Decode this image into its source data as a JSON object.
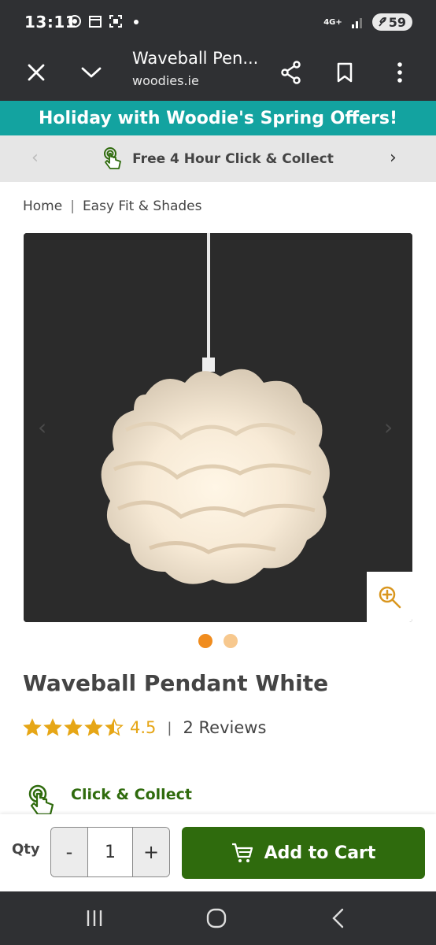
{
  "status_bar": {
    "time": "13:11",
    "network": "4G+",
    "battery": "59"
  },
  "browser": {
    "tab_title": "Waveball Pen...",
    "url": "woodies.ie"
  },
  "promo_banner": {
    "text": "Holiday with Woodie's Spring Offers!",
    "bg_color": "#13a3a0"
  },
  "usp_bar": {
    "text": "Free 4 Hour Click & Collect"
  },
  "breadcrumb": [
    "Home",
    "Easy Fit & Shades"
  ],
  "product": {
    "title": "Waveball Pendant White",
    "rating": "4.5",
    "rating_fraction": 0.9,
    "reviews": "2 Reviews",
    "image_count": 2,
    "active_image_index": 0
  },
  "fulfilment": {
    "click_collect_label": "Click & Collect"
  },
  "cart": {
    "qty_label": "Qty",
    "minus": "-",
    "qty": "1",
    "plus": "+",
    "add_label": "Add to Cart",
    "brand_color": "#2f6b0d"
  },
  "colors": {
    "star": "#e6a616",
    "dot_active": "#f08c1e",
    "dot_inactive": "#f7c88e"
  }
}
